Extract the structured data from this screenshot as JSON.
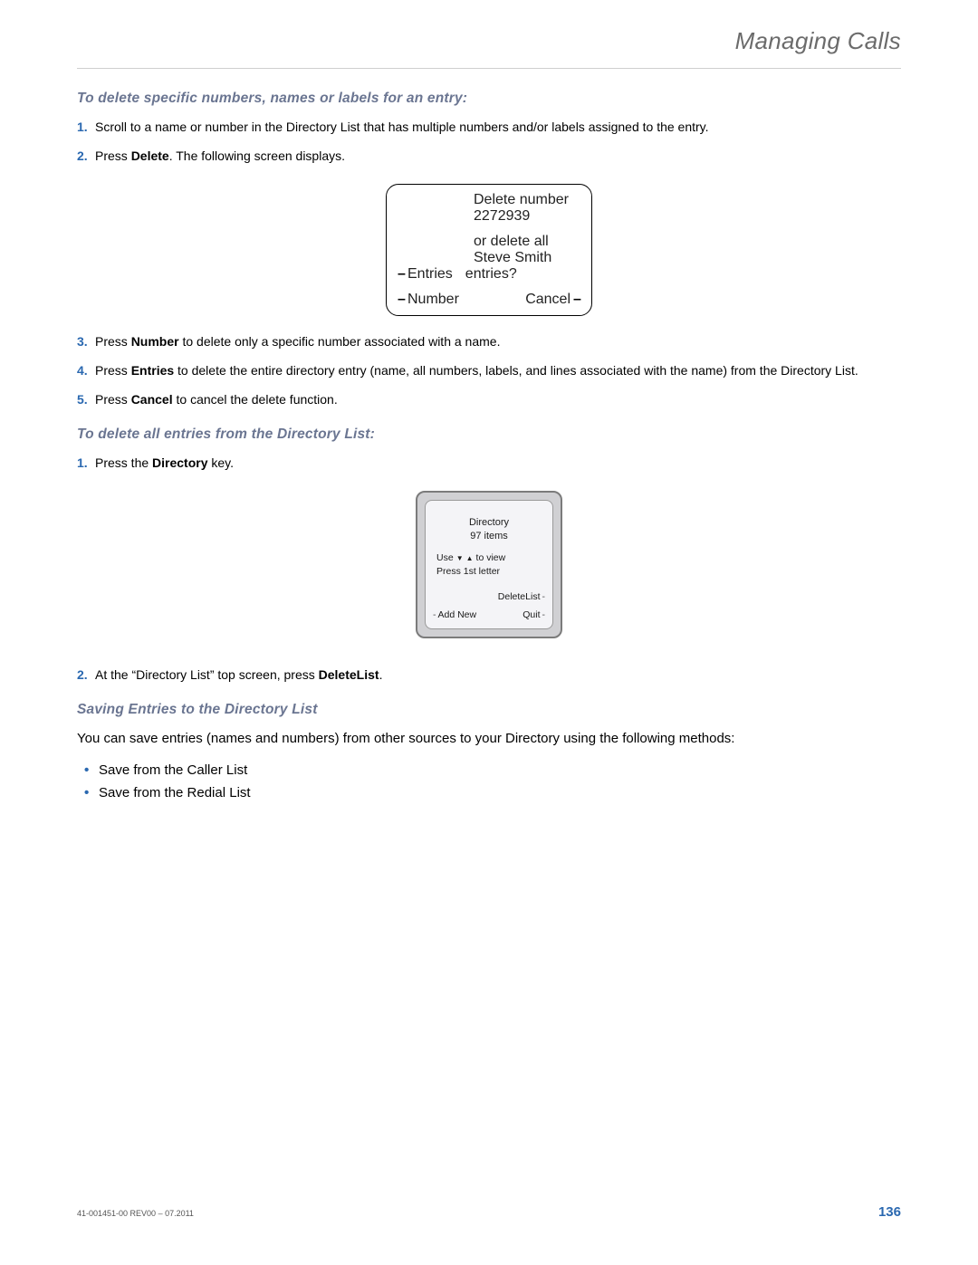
{
  "header": {
    "title": "Managing Calls"
  },
  "section1": {
    "heading": "To delete specific numbers, names or labels for an entry:",
    "steps": [
      {
        "text": "Scroll to a name or number in the Directory List that has multiple numbers and/or labels assigned to the entry."
      },
      {
        "prefix": "Press ",
        "bold": "Delete",
        "suffix": ". The following screen displays."
      },
      {
        "prefix": "Press ",
        "bold": "Number",
        "suffix": " to delete only a specific number associated with a name."
      },
      {
        "prefix": "Press ",
        "bold": "Entries",
        "suffix": " to delete the entire directory entry (name, all numbers, labels, and lines associated with the name) from the Directory List."
      },
      {
        "prefix": "Press ",
        "bold": "Cancel",
        "suffix": " to cancel the delete function."
      }
    ]
  },
  "screen1": {
    "line1": "Delete number",
    "line2": "2272939",
    "line3": "or delete all",
    "line4": "Steve Smith",
    "sk_entries": "Entries",
    "sk_entries_right": "entries?",
    "sk_number": "Number",
    "sk_cancel": "Cancel"
  },
  "section2": {
    "heading": "To delete all entries from the Directory List:",
    "steps": [
      {
        "prefix": "Press the ",
        "bold": "Directory",
        "suffix": " key."
      },
      {
        "prefix": "At the “Directory List” top screen, press ",
        "bold": "DeleteList",
        "suffix": "."
      }
    ]
  },
  "screen2": {
    "title": "Directory",
    "count": "97 items",
    "use_prefix": "Use",
    "use_suffix": "to view",
    "press": "Press 1st letter",
    "sk_deletelist": "DeleteList",
    "sk_addnew": "Add New",
    "sk_quit": "Quit"
  },
  "section3": {
    "heading": "Saving Entries to the Directory List",
    "intro": "You can save entries (names and numbers) from other sources to your Directory using the following methods:",
    "bullets": [
      "Save from the Caller List",
      "Save from the Redial List"
    ]
  },
  "footer": {
    "left": "41-001451-00 REV00 – 07.2011",
    "right": "136"
  }
}
